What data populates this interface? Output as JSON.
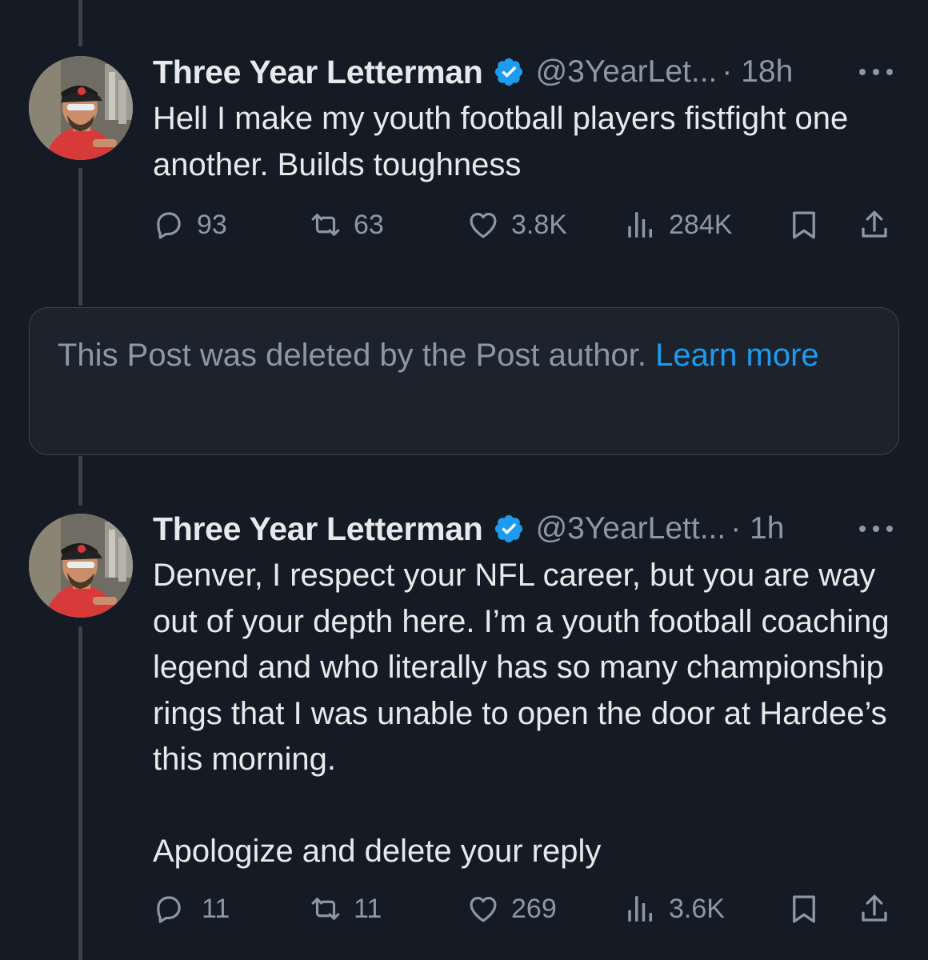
{
  "tweets": [
    {
      "display_name": "Three Year Letterman",
      "handle": "@3YearLet...",
      "time": "· 18h",
      "text": "Hell I make my youth football players fistfight one another. Builds toughness",
      "replies": "93",
      "reposts": "63",
      "likes": "3.8K",
      "views": "284K"
    },
    {
      "display_name": "Three Year Letterman",
      "handle": "@3YearLett...",
      "time": "· 1h",
      "text": "Denver, I respect your NFL career, but you are way out of your depth here. I’m a youth football coaching legend and who literally has so many championship rings that I was unable to open the door at Hardee’s this morning.\n\nApologize and delete your reply",
      "replies": "11",
      "reposts": "11",
      "likes": "269",
      "views": "3.6K"
    }
  ],
  "deleted_notice": {
    "text": "This Post was deleted by the Post author. ",
    "link": "Learn more"
  },
  "icons": {
    "reply": "reply-icon",
    "repost": "repost-icon",
    "like": "like-icon",
    "views": "views-icon",
    "bookmark": "bookmark-icon",
    "share": "share-icon",
    "more": "more-icon",
    "verified": "verified-badge-icon"
  },
  "colors": {
    "background": "#151b25",
    "text": "#e7e9ea",
    "muted": "#8b98a5",
    "accent": "#1d9bf0",
    "thread_line": "#3a424c"
  }
}
